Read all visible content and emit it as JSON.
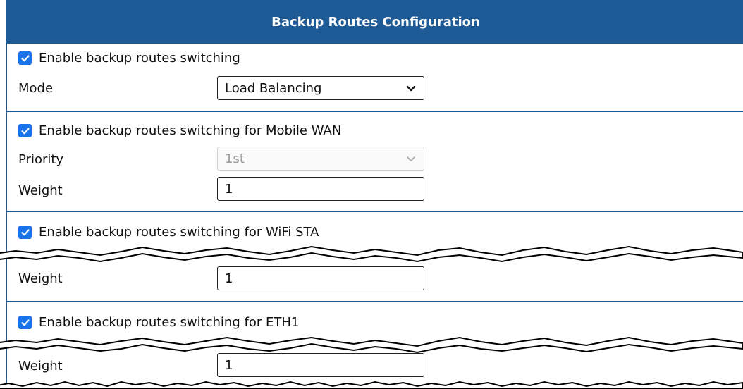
{
  "header": {
    "title": "Backup Routes Configuration"
  },
  "general": {
    "enable_label": "Enable backup routes switching",
    "enable_checked": true,
    "mode_label": "Mode",
    "mode_value": "Load Balancing"
  },
  "mobile_wan": {
    "enable_label": "Enable backup routes switching for Mobile WAN",
    "enable_checked": true,
    "priority_label": "Priority",
    "priority_value": "1st",
    "weight_label": "Weight",
    "weight_value": "1"
  },
  "wifi_sta": {
    "enable_label": "Enable backup routes switching for WiFi STA",
    "enable_checked": true,
    "weight_label": "Weight",
    "weight_value": "1"
  },
  "eth1": {
    "enable_label": "Enable backup routes switching for ETH1",
    "enable_checked": true,
    "weight_label": "Weight",
    "weight_value": "1"
  },
  "colors": {
    "header": "#1e5a96",
    "checkbox": "#1a73e8"
  }
}
